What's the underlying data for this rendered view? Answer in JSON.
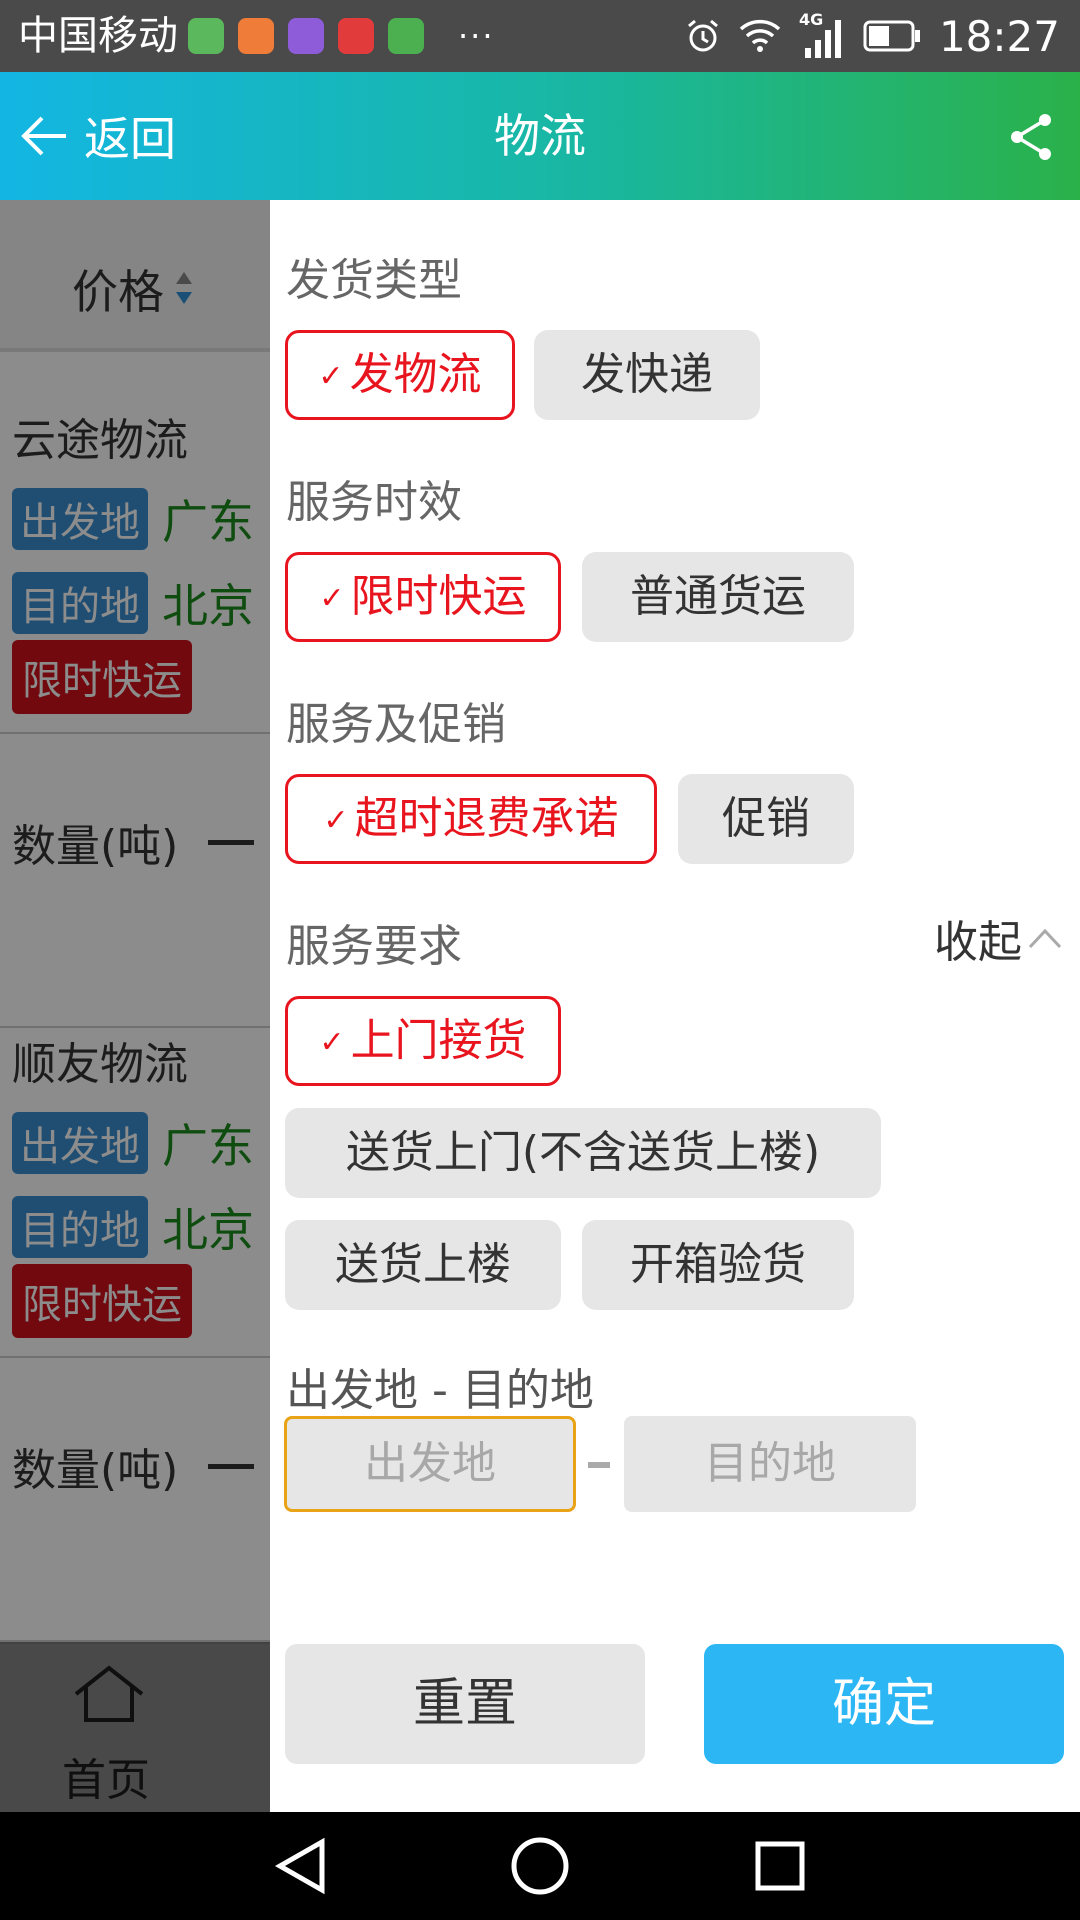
{
  "status_bar": {
    "carrier": "中国移动",
    "more": "···",
    "network": "4G",
    "time": "18:27"
  },
  "header": {
    "back_label": "返回",
    "title": "物流"
  },
  "background_list": {
    "sort_label": "价格",
    "cards": [
      {
        "company": "云途物流",
        "origin_tag": "出发地",
        "origin_value": "广东",
        "dest_tag": "目的地",
        "dest_value": "北京",
        "service_tag": "限时快运",
        "qty_label": "数量(吨)"
      },
      {
        "company": "顺友物流",
        "origin_tag": "出发地",
        "origin_value": "广东",
        "dest_tag": "目的地",
        "dest_value": "北京",
        "service_tag": "限时快运",
        "qty_label": "数量(吨)"
      }
    ],
    "bottom_nav_home": "首页"
  },
  "filter": {
    "sections": [
      {
        "title": "发货类型",
        "options": [
          {
            "label": "发物流",
            "selected": true
          },
          {
            "label": "发快递",
            "selected": false
          }
        ]
      },
      {
        "title": "服务时效",
        "options": [
          {
            "label": "限时快运",
            "selected": true
          },
          {
            "label": "普通货运",
            "selected": false
          }
        ]
      },
      {
        "title": "服务及促销",
        "options": [
          {
            "label": "超时退费承诺",
            "selected": true
          },
          {
            "label": "促销",
            "selected": false
          }
        ]
      },
      {
        "title": "服务要求",
        "options": [
          {
            "label": "上门接货",
            "selected": true
          },
          {
            "label": "送货上门(不含送货上楼)",
            "selected": false
          },
          {
            "label": "送货上楼",
            "selected": false
          },
          {
            "label": "开箱验货",
            "selected": false
          }
        ]
      }
    ],
    "collapse_label": "收起",
    "check_mark": "✓",
    "route": {
      "title": "出发地 - 目的地",
      "origin_placeholder": "出发地",
      "dest_placeholder": "目的地"
    },
    "reset_label": "重置",
    "confirm_label": "确定"
  },
  "colors": {
    "selected_red": "#e8141e",
    "confirm_blue": "#2cb6f4",
    "tag_blue": "#3a8fd0",
    "tag_red": "#d0111b",
    "location_green": "#1d8a1d"
  }
}
